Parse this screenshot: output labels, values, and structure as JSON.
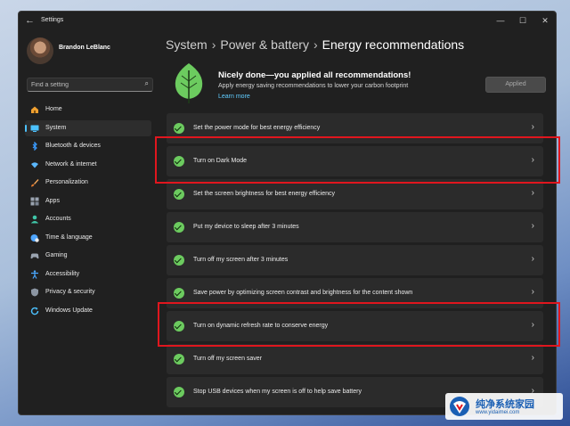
{
  "window": {
    "title": "Settings",
    "back_glyph": "←",
    "controls": {
      "minimize": "—",
      "maximize": "☐",
      "close": "✕"
    }
  },
  "user": {
    "name": "Brandon LeBlanc"
  },
  "search": {
    "placeholder": "Find a setting",
    "icon": "search-icon"
  },
  "sidebar": {
    "items": [
      {
        "label": "Home",
        "icon": "home-icon",
        "color": "#f0a030"
      },
      {
        "label": "System",
        "icon": "system-icon",
        "color": "#4cc2ff",
        "active": true
      },
      {
        "label": "Bluetooth & devices",
        "icon": "bluetooth-icon",
        "color": "#3a9bff"
      },
      {
        "label": "Network & internet",
        "icon": "wifi-icon",
        "color": "#5bb8ff"
      },
      {
        "label": "Personalization",
        "icon": "brush-icon",
        "color": "#f2a65a"
      },
      {
        "label": "Apps",
        "icon": "apps-icon",
        "color": "#9aa3b0"
      },
      {
        "label": "Accounts",
        "icon": "person-icon",
        "color": "#3fc6a8"
      },
      {
        "label": "Time & language",
        "icon": "globe-clock-icon",
        "color": "#4fa6ff"
      },
      {
        "label": "Gaming",
        "icon": "gamepad-icon",
        "color": "#9aa3b0"
      },
      {
        "label": "Accessibility",
        "icon": "accessibility-icon",
        "color": "#4aa8ff"
      },
      {
        "label": "Privacy & security",
        "icon": "shield-icon",
        "color": "#8c96a3"
      },
      {
        "label": "Windows Update",
        "icon": "update-icon",
        "color": "#4cc2ff"
      }
    ]
  },
  "breadcrumb": {
    "items": [
      "System",
      "Power & battery",
      "Energy recommendations"
    ],
    "separator": "›"
  },
  "hero": {
    "title": "Nicely done—you applied all recommendations!",
    "subtitle": "Apply energy saving recommendations to lower your carbon footprint",
    "link": "Learn more",
    "button": "Applied",
    "icon": "leaf-icon"
  },
  "recommendations": [
    {
      "label": "Set the power mode for best energy efficiency"
    },
    {
      "label": "Turn on Dark Mode"
    },
    {
      "label": "Set the screen brightness for best energy efficiency"
    },
    {
      "label": "Put my device to sleep after 3 minutes"
    },
    {
      "label": "Turn off my screen after 3 minutes"
    },
    {
      "label": "Save power by optimizing screen contrast and brightness for the content shown"
    },
    {
      "label": "Turn on dynamic refresh rate to conserve energy"
    },
    {
      "label": "Turn off my screen saver"
    },
    {
      "label": "Stop USB devices when my screen is off to help save battery"
    }
  ],
  "chevron": "›",
  "watermark": {
    "cn": "纯净系统家园",
    "url": "www.yidaimei.com"
  },
  "colors": {
    "accent": "#4cc2ff",
    "check": "#6ccb5f",
    "highlight": "#e0161e",
    "link": "#60cdff"
  }
}
